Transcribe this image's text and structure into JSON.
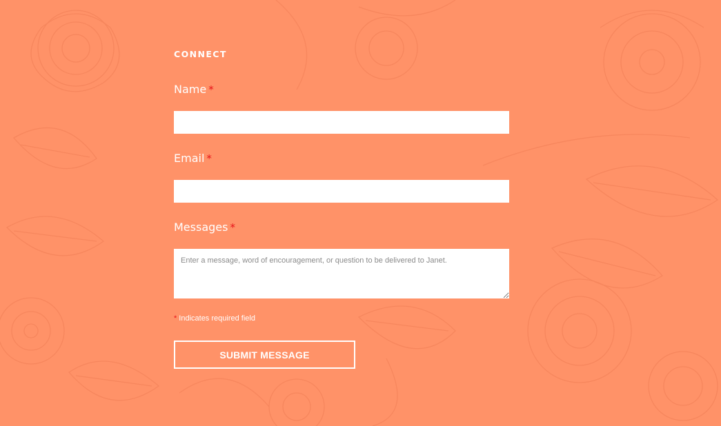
{
  "section": {
    "title": "CONNECT"
  },
  "fields": {
    "name": {
      "label": "Name",
      "required_mark": "*",
      "value": ""
    },
    "email": {
      "label": "Email",
      "required_mark": "*",
      "value": ""
    },
    "message": {
      "label": "Messages",
      "required_mark": "*",
      "placeholder": "Enter a message, word of encouragement, or question to be delivered to Janet.",
      "value": ""
    }
  },
  "required_note": {
    "mark": "*",
    "text": "Indicates required field"
  },
  "submit": {
    "label": "SUBMIT MESSAGE"
  },
  "colors": {
    "background": "#ff9268",
    "required": "#e8151b",
    "text": "#ffffff"
  }
}
